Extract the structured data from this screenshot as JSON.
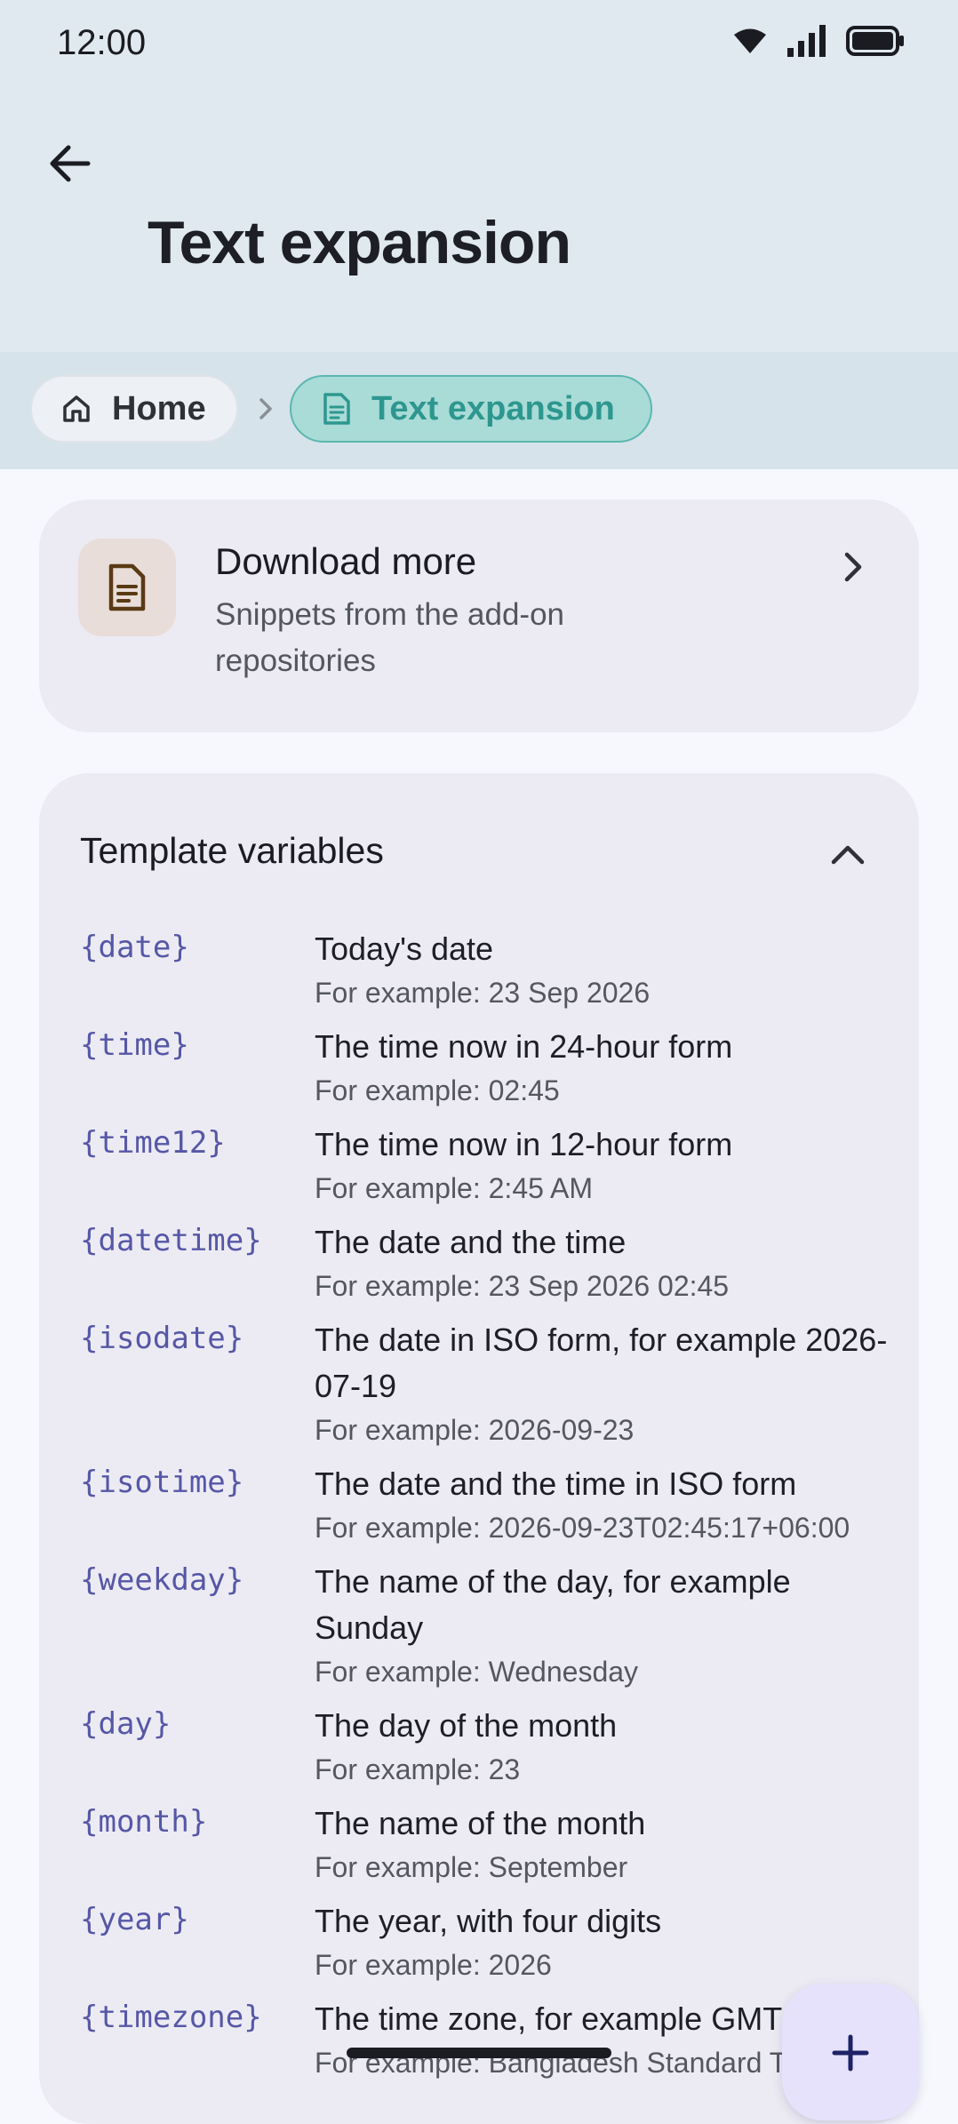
{
  "status_bar": {
    "time": "12:00"
  },
  "app_bar": {
    "title": "Text expansion"
  },
  "breadcrumb": [
    {
      "label": "Home",
      "icon": "home-icon"
    },
    {
      "label": "Text expansion",
      "icon": "document-icon"
    }
  ],
  "download_card": {
    "title": "Download more",
    "subtitle": "Snippets from the add-on repositories",
    "icon": "document-icon"
  },
  "template_section": {
    "title": "Template variables",
    "expanded": true,
    "variables": [
      {
        "name": "{date}",
        "description": "Today's date",
        "example": "For example: 23 Sep 2026"
      },
      {
        "name": "{time}",
        "description": "The time now in 24-hour form",
        "example": "For example: 02:45"
      },
      {
        "name": "{time12}",
        "description": "The time now in 12-hour form",
        "example": "For example: 2:45 AM"
      },
      {
        "name": "{datetime}",
        "description": "The date and the time",
        "example": "For example: 23 Sep 2026 02:45"
      },
      {
        "name": "{isodate}",
        "description": "The date in ISO form, for example 2026-07-19",
        "example": "For example: 2026-09-23"
      },
      {
        "name": "{isotime}",
        "description": "The date and the time in ISO form",
        "example": "For example: 2026-09-23T02:45:17+06:00"
      },
      {
        "name": "{weekday}",
        "description": "The name of the day, for example Sunday",
        "example": "For example: Wednesday"
      },
      {
        "name": "{day}",
        "description": "The day of the month",
        "example": "For example: 23"
      },
      {
        "name": "{month}",
        "description": "The name of the month",
        "example": "For example: September"
      },
      {
        "name": "{year}",
        "description": "The year, with four digits",
        "example": "For example: 2026"
      },
      {
        "name": "{timezone}",
        "description": "The time zone, for example GMT+06:00",
        "example": "For example: Bangladesh Standard Time"
      }
    ]
  },
  "colors": {
    "accent": "#2d978f",
    "variable": "#5657a6",
    "header": "#dfe9ef"
  }
}
